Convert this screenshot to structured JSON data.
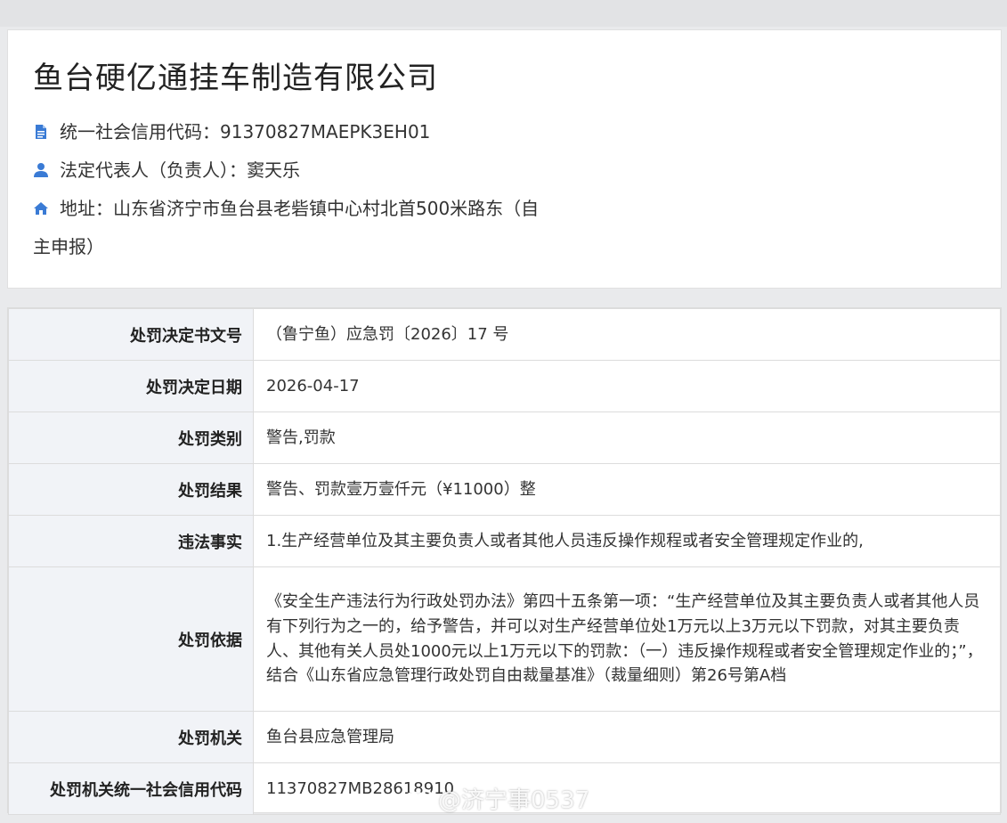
{
  "company": {
    "name": "鱼台硬亿通挂车制造有限公司",
    "credit_code_line": "统一社会信用代码：91370827MAEPK3EH01",
    "legal_rep_line": "法定代表人（负责人）：窦天乐",
    "address_line1": "地址：山东省济宁市鱼台县老砦镇中心村北首500米路东（自",
    "address_line2": "主申报）"
  },
  "penalty": {
    "rows": [
      {
        "label": "处罚决定书文号",
        "value": "（鲁宁鱼）应急罚〔2026〕17 号"
      },
      {
        "label": "处罚决定日期",
        "value": "2026-04-17"
      },
      {
        "label": "处罚类别",
        "value": "警告,罚款"
      },
      {
        "label": "处罚结果",
        "value": "警告、罚款壹万壹仟元（¥11000）整"
      },
      {
        "label": "违法事实",
        "value": "1.生产经营单位及其主要负责人或者其他人员违反操作规程或者安全管理规定作业的,"
      },
      {
        "label": "处罚依据",
        "value": "《安全生产违法行为行政处罚办法》第四十五条第一项：“生产经营单位及其主要负责人或者其他人员有下列行为之一的，给予警告，并可以对生产经营单位处1万元以上3万元以下罚款，对其主要负责人、其他有关人员处1000元以上1万元以下的罚款：（一）违反操作规程或者安全管理规定作业的；”，结合《山东省应急管理行政处罚自由裁量基准》（裁量细则）第26号第A档"
      },
      {
        "label": "处罚机关",
        "value": "鱼台县应急管理局"
      },
      {
        "label": "处罚机关统一社会信用代码",
        "value": "11370827MB28618910"
      }
    ]
  },
  "watermark": {
    "text": "@济宁事0537",
    "icon": "weibo-icon"
  },
  "icons": {
    "credit": "document-icon",
    "person": "person-icon",
    "address": "home-icon"
  },
  "colors": {
    "icon_blue": "#3a7bd5",
    "label_bg": "#f1f3f7",
    "border": "#dcdcdc"
  }
}
